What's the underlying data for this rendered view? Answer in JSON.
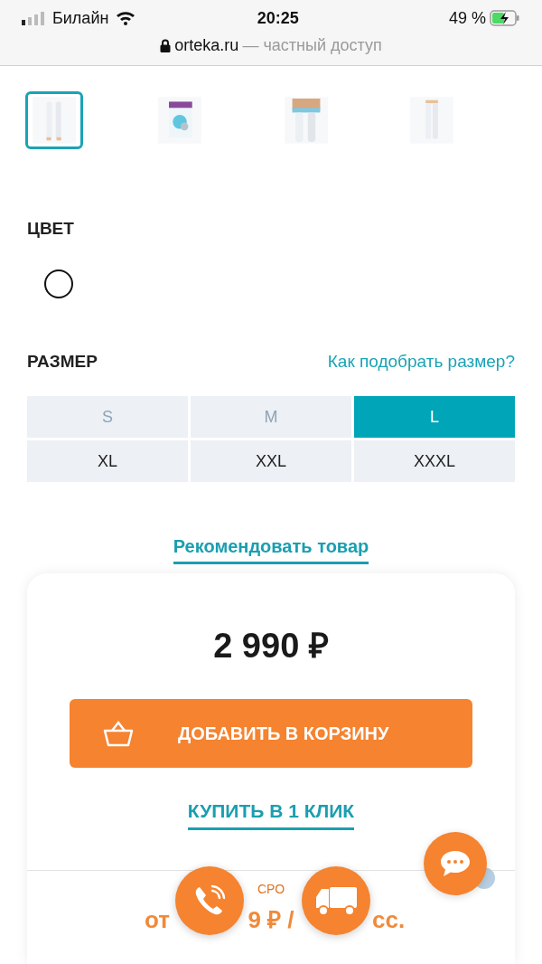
{
  "status_bar": {
    "carrier": "Билайн",
    "time": "20:25",
    "battery": "49 %"
  },
  "address_bar": {
    "domain": "orteka.ru",
    "note": "— частный доступ"
  },
  "thumbnails": [
    {
      "selected": true
    },
    {
      "selected": false
    },
    {
      "selected": false
    },
    {
      "selected": false
    }
  ],
  "color_section": {
    "title": "ЦВЕТ",
    "swatches": [
      {
        "color": "#ffffff"
      }
    ]
  },
  "size_section": {
    "title": "РАЗМЕР",
    "guide_link": "Как подобрать размер?"
  },
  "sizes": [
    {
      "label": "S",
      "selected": false,
      "disabled": true
    },
    {
      "label": "M",
      "selected": false,
      "disabled": true
    },
    {
      "label": "L",
      "selected": true,
      "disabled": false
    },
    {
      "label": "XL",
      "selected": false,
      "disabled": false
    },
    {
      "label": "XXL",
      "selected": false,
      "disabled": false
    },
    {
      "label": "XXXL",
      "selected": false,
      "disabled": false
    }
  ],
  "recommend_link": "Рекомендовать товар",
  "purchase": {
    "price": "2 990 ₽",
    "add_to_cart": "ДОБАВИТЬ В КОРЗИНУ",
    "one_click": "КУПИТЬ В 1 КЛИК"
  },
  "installment": {
    "label_fragment": "СРО",
    "amount_fragments": [
      "от",
      "9 ₽ /",
      "сс."
    ]
  }
}
